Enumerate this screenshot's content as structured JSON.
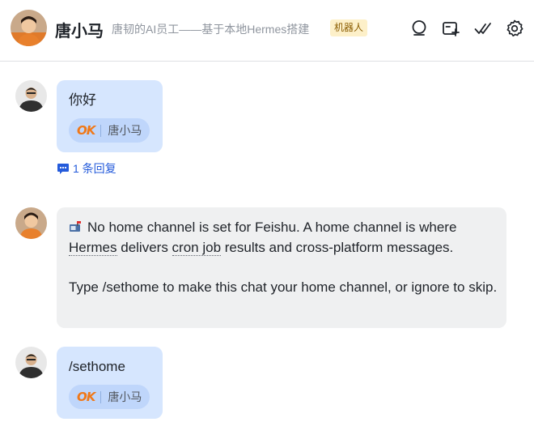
{
  "header": {
    "chat_name": "唐小马",
    "chat_description": "唐韧的AI员工——基于本地Hermes搭建",
    "badge": "机器人",
    "actions": [
      "search-icon",
      "add-tab-icon",
      "check-mark-icon",
      "settings-gear-icon"
    ]
  },
  "messages": [
    {
      "sender": "user",
      "text": "你好",
      "reaction": {
        "emoji": "OK",
        "users": "唐小马"
      },
      "reply_count_label": "1 条回复"
    },
    {
      "sender": "bot",
      "icon": "mailbox-icon",
      "line1_a": "No home channel is set for Feishu. A home channel is where",
      "link1": "Hermes",
      "line2_a": " delivers ",
      "link2": "cron job",
      "line2_b": " results and cross-platform messages.",
      "paragraph2": "Type /sethome to make this chat your home channel, or ignore to skip."
    },
    {
      "sender": "user",
      "text": "/sethome",
      "reaction": {
        "emoji": "OK",
        "users": "唐小马"
      }
    }
  ],
  "colors": {
    "my_bubble": "#d6e6fe",
    "bot_bubble": "#eff0f1",
    "link": "#245bdb",
    "badge_bg": "#fdf0c9",
    "ok_emoji": "#f07818"
  }
}
